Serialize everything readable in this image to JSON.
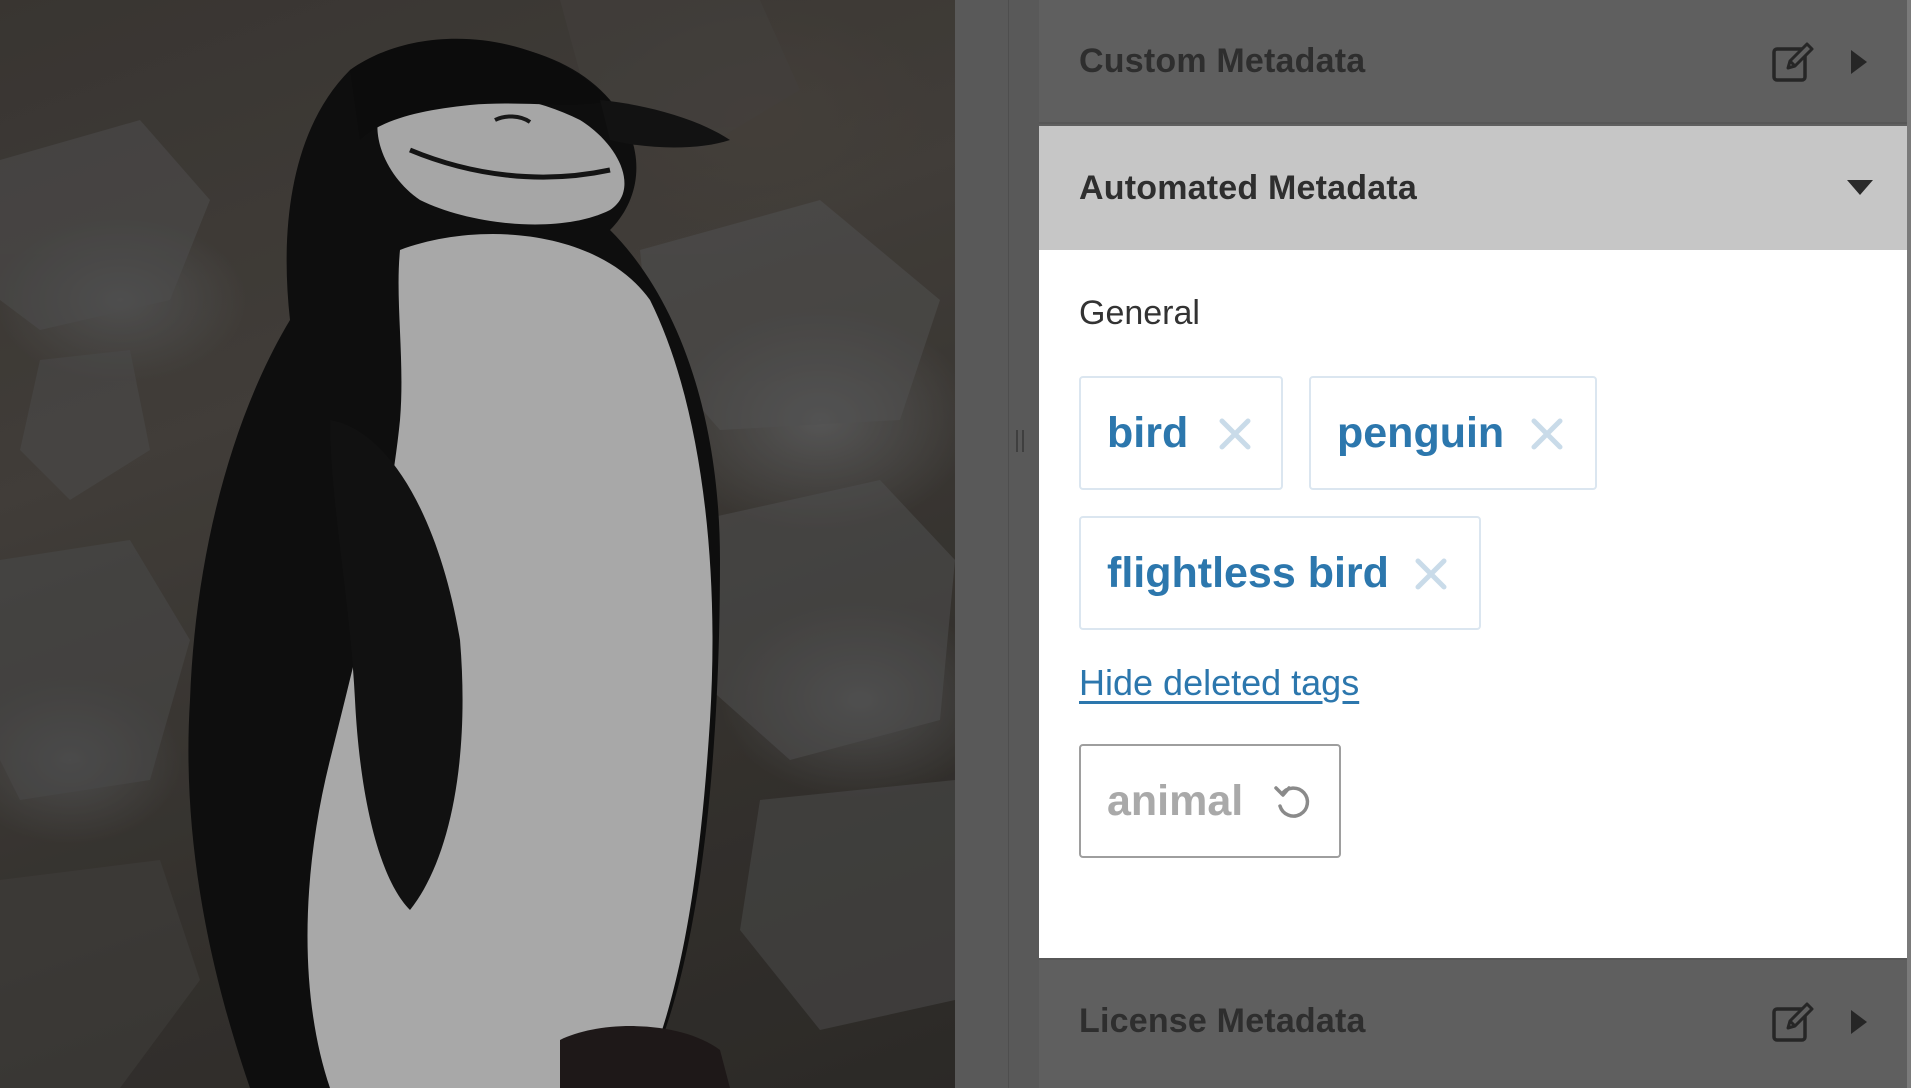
{
  "preview": {
    "image_icon": "chinstrap-penguin-photo"
  },
  "sections": {
    "custom": {
      "title": "Custom Metadata",
      "edit_icon": "edit-pencil-square-icon",
      "toggle_icon": "caret-right-icon",
      "expanded": false
    },
    "automated": {
      "title": "Automated Metadata",
      "toggle_icon": "caret-down-icon",
      "expanded": true,
      "group": {
        "title": "General",
        "tags": [
          {
            "label": "bird",
            "action_icon": "close-x-icon"
          },
          {
            "label": "penguin",
            "action_icon": "close-x-icon"
          },
          {
            "label": "flightless bird",
            "action_icon": "close-x-icon"
          }
        ],
        "toggle_deleted_label": "Hide deleted tags",
        "deleted_tags": [
          {
            "label": "animal",
            "action_icon": "restore-undo-icon"
          }
        ]
      }
    },
    "license": {
      "title": "License Metadata",
      "edit_icon": "edit-pencil-square-icon",
      "toggle_icon": "caret-right-icon",
      "expanded": false
    }
  },
  "colors": {
    "tag_text": "#2c77ad",
    "tag_border": "#dbe6f0",
    "remove_icon": "#c9dbe9",
    "deleted_text": "#a9a9a9",
    "active_header_bg": "#c6c6c6",
    "inactive_header_bg": "#5f5f5f"
  }
}
